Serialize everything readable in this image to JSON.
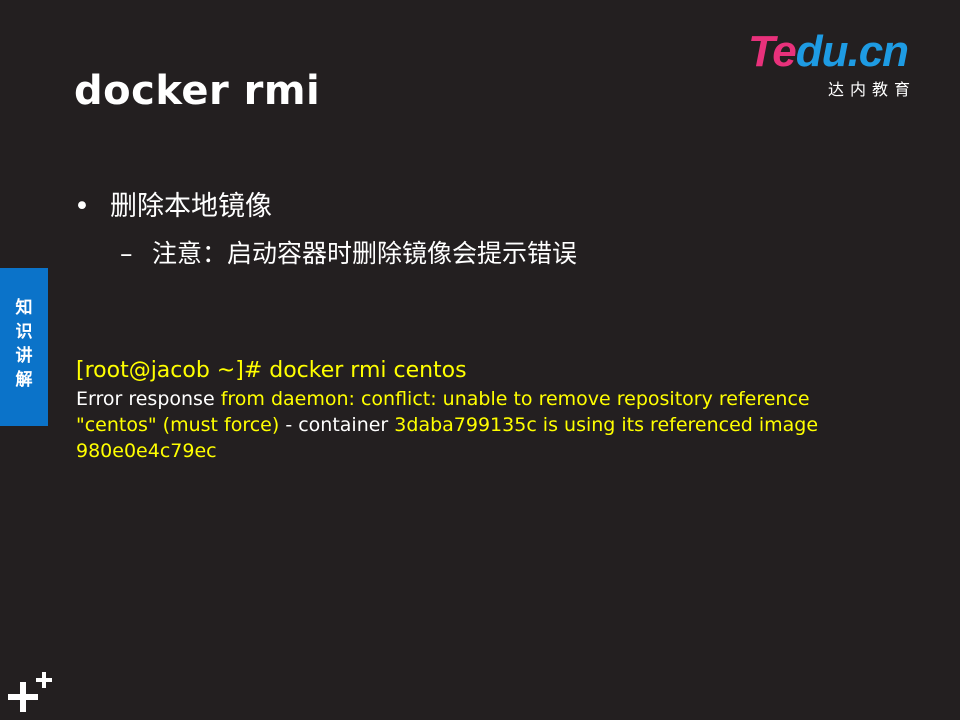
{
  "slide": {
    "title": "docker rmi",
    "logo": {
      "brand_part1": "Te",
      "brand_part2": "du.cn",
      "subtitle": "达内教育"
    },
    "bullet": "删除本地镜像",
    "sub_bullet": "注意：启动容器时删除镜像会提示错误",
    "side_tab": [
      "知",
      "识",
      "讲",
      "解"
    ],
    "code": {
      "command": "[root@jacob ~]# docker rmi centos",
      "out_1": "Error response",
      "out_2": " from daemon: conflict: unable to remove repository reference",
      "out_3": "\"centos\" (must force)",
      "out_4": " - container ",
      "out_5": "3daba799135c  is using its referenced image",
      "out_6": "980e0e4c79ec"
    },
    "colors": {
      "background": "#231f20",
      "accent_blue": "#0b73c9",
      "code_yellow": "#ffff00",
      "logo_pink": "#e8317b",
      "logo_blue": "#1e9be3"
    },
    "icons": [
      "plus-icon"
    ]
  }
}
